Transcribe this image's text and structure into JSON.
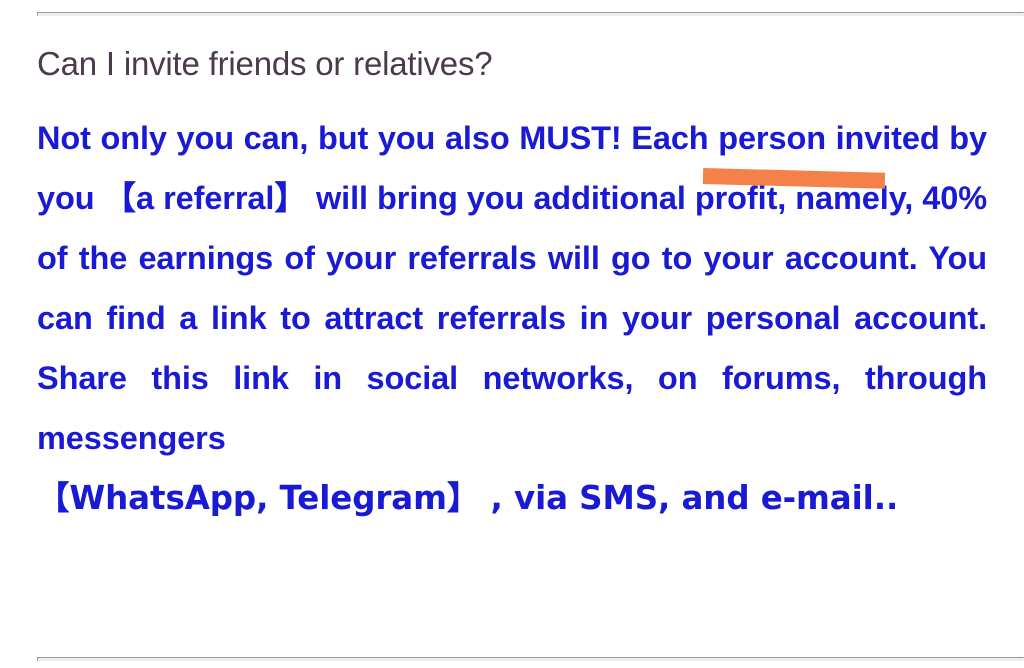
{
  "page": {
    "background_color": "#ffffff",
    "divider_color": "#ececec"
  },
  "faq": {
    "question": "Can I invite friends or relatives?",
    "answer_full": "Not only you can, but you also MUST! Each person invited by you 【a referral】 will bring you additional profit, namely, 40% of the earnings of your referrals will go to your account. You can find a link to attract referrals in your personal account. Share this link in social networks, on forums, through messengers 【WhatsApp, Telegram】, via SMS, and e-mail..",
    "answer_main": "Not only you can, but you also MUST! Each person invited by you 【a referral】 will bring you additional profit, namely, 40% of the earnings of your referrals will go to your account. You can find a link to attract referrals in your personal account. Share this link in social networks, on forums, through messengers",
    "answer_last_line": "【WhatsApp, Telegram】 , via SMS, and e-mail..",
    "question_color": "#4b3a4c",
    "answer_color": "#1a1ad4",
    "highlight_word": "MUST!",
    "highlight_color": "#f5814a",
    "referral_percent": "40%",
    "bracketed_terms": [
      "a referral",
      "WhatsApp, Telegram"
    ],
    "channels": [
      "social networks",
      "forums",
      "messengers",
      "WhatsApp",
      "Telegram",
      "SMS",
      "e-mail"
    ]
  }
}
